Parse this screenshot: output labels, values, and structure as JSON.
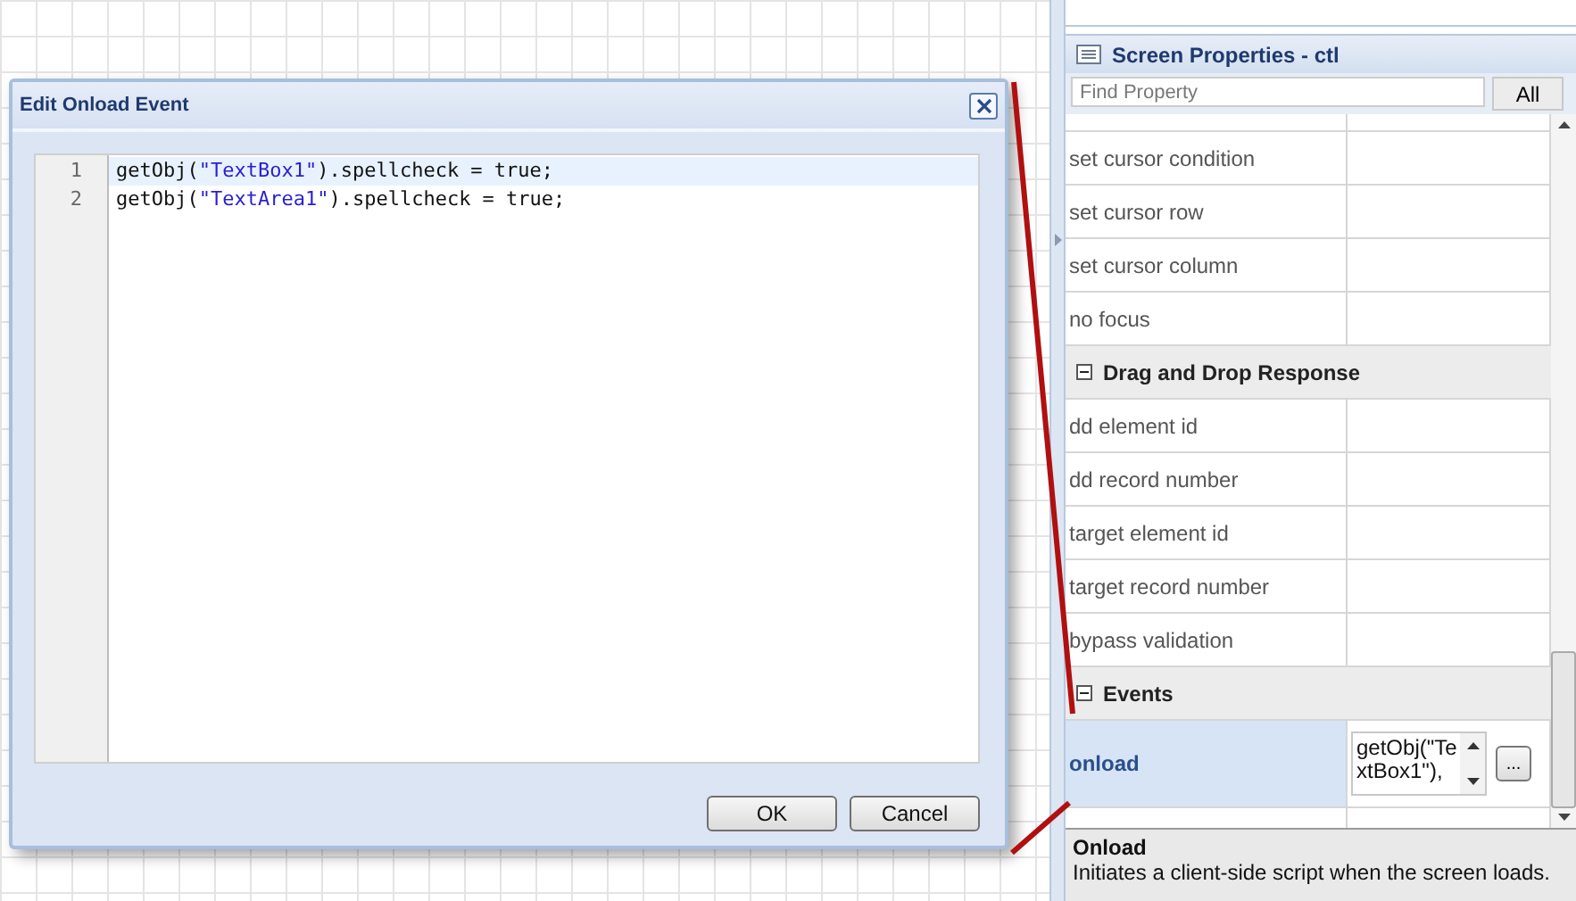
{
  "dialog": {
    "title": "Edit Onload Event",
    "code_lines": [
      {
        "number": "1",
        "selected": true,
        "tokens": [
          {
            "kind": "plain",
            "text": "getObj("
          },
          {
            "kind": "string",
            "text": "\"TextBox1\""
          },
          {
            "kind": "plain",
            "text": ").spellcheck = true;"
          }
        ]
      },
      {
        "number": "2",
        "selected": false,
        "tokens": [
          {
            "kind": "plain",
            "text": "getObj("
          },
          {
            "kind": "string",
            "text": "\"TextArea1\""
          },
          {
            "kind": "plain",
            "text": ").spellcheck = true;"
          }
        ]
      }
    ],
    "buttons": [
      "OK",
      "Cancel"
    ]
  },
  "properties_panel": {
    "title": "Screen Properties - ctl",
    "search": {
      "placeholder": "Find Property"
    },
    "filter_button": "All",
    "rows": [
      {
        "kind": "property",
        "label": "set cursor condition",
        "selected": false
      },
      {
        "kind": "property",
        "label": "set cursor row",
        "selected": false
      },
      {
        "kind": "property",
        "label": "set cursor column",
        "selected": false
      },
      {
        "kind": "property",
        "label": "no focus",
        "selected": false
      },
      {
        "kind": "section",
        "label": "Drag and Drop Response",
        "expanded": true
      },
      {
        "kind": "property",
        "label": "dd element id",
        "selected": false
      },
      {
        "kind": "property",
        "label": "dd record number",
        "selected": false
      },
      {
        "kind": "property",
        "label": "target element id",
        "selected": false
      },
      {
        "kind": "property",
        "label": "target record number",
        "selected": false
      },
      {
        "kind": "property",
        "label": "bypass validation",
        "selected": false
      },
      {
        "kind": "section",
        "label": "Events",
        "expanded": true
      },
      {
        "kind": "script",
        "label": "onload",
        "selected": true,
        "value": "getObj(\"TextBox1\"),",
        "button": "..."
      }
    ],
    "description": {
      "title": "Onload",
      "text": "Initiates a client-side script when the screen loads."
    }
  }
}
